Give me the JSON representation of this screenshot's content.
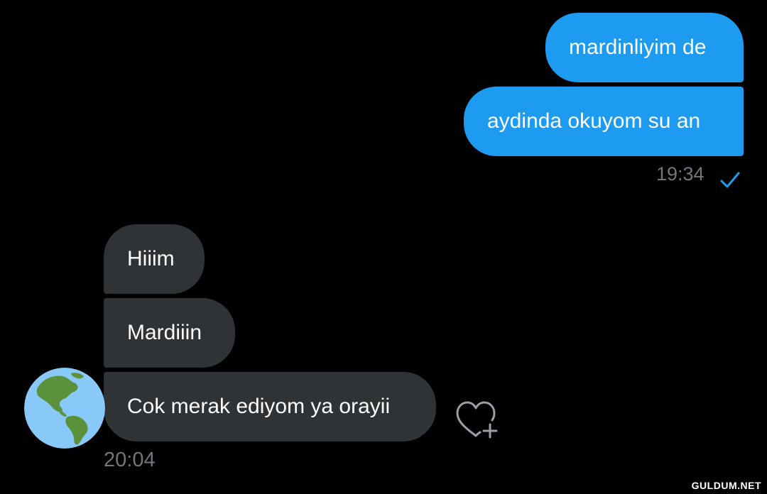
{
  "conversation": {
    "sent_messages": [
      {
        "text": "mardinliyim de"
      },
      {
        "text": "aydinda okuyom su an"
      }
    ],
    "sent_time": "19:34",
    "sent_status_icon": "check-icon",
    "received_messages": [
      {
        "text": "Hiiim"
      },
      {
        "text": "Mardiiin"
      },
      {
        "text": "Cok merak ediyom ya orayii"
      }
    ],
    "received_time": "20:04",
    "sender_avatar_icon": "globe-americas-icon",
    "reaction_icon": "heart-plus-icon"
  },
  "watermark": "GULDUM.NET",
  "colors": {
    "background": "#000000",
    "sent_bubble": "#1d9bf0",
    "received_bubble": "#2f3336",
    "timestamp": "#71767b",
    "read_check": "#1d9bf0"
  }
}
